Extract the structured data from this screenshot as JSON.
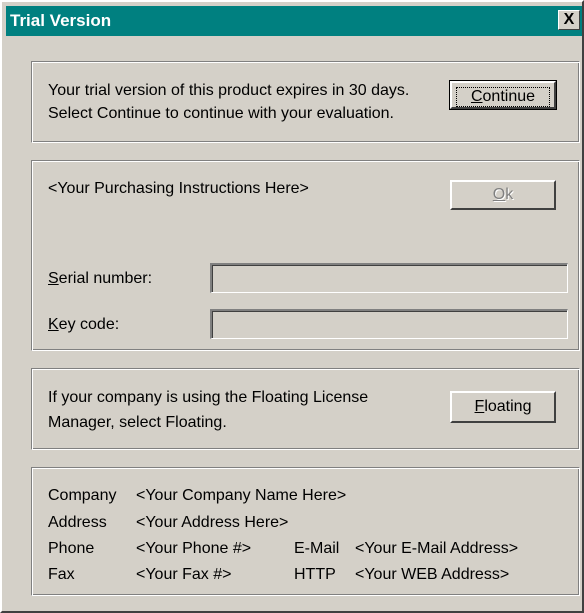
{
  "window": {
    "title": "Trial Version",
    "close_glyph": "X"
  },
  "expiry": {
    "line1": "Your trial version of this product expires in 30 days.",
    "line2": "Select Continue to continue with your evaluation.",
    "continue_first": "C",
    "continue_rest": "ontinue"
  },
  "purchase": {
    "instructions": "<Your Purchasing Instructions Here>",
    "ok_first": "O",
    "ok_rest": "k",
    "serial_first": "S",
    "serial_rest": "erial number:",
    "serial_value": "",
    "key_first": "K",
    "key_rest": "ey code:",
    "key_value": ""
  },
  "floating": {
    "line1": "If your company is using the Floating License",
    "line2": "Manager, select Floating.",
    "button_first": "F",
    "button_rest": "loating"
  },
  "contact": {
    "company_label": "Company",
    "company_value": "<Your Company Name Here>",
    "address_label": "Address",
    "address_value": "<Your Address Here>",
    "phone_label": "Phone",
    "phone_value": "<Your Phone #>",
    "email_label": "E-Mail",
    "email_value": "<Your E-Mail Address>",
    "fax_label": "Fax",
    "fax_value": "<Your Fax #>",
    "http_label": "HTTP",
    "http_value": "<Your WEB Address>"
  }
}
